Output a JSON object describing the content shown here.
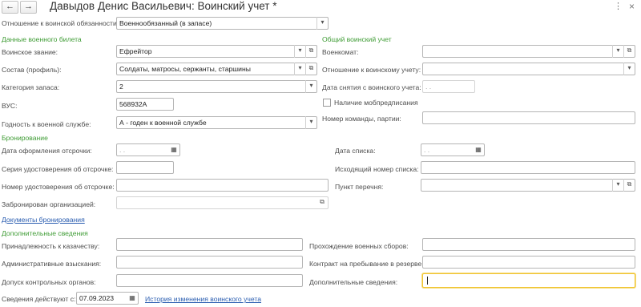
{
  "window": {
    "title": "Давыдов Денис Васильевич: Воинский учет *",
    "back_icon": "←",
    "forward_icon": "→",
    "more_icon": "⋮",
    "close_icon": "×"
  },
  "relation": {
    "label": "Отношение к воинской обязанности:",
    "value": "Военнообязанный (в запасе)"
  },
  "military_ticket": {
    "heading": "Данные военного билета",
    "rank_label": "Воинское звание:",
    "rank_value": "Ефрейтор",
    "profile_label": "Состав (профиль):",
    "profile_value": "Солдаты, матросы, сержанты, старшины",
    "reserve_label": "Категория запаса:",
    "reserve_value": "2",
    "vus_label": "ВУС:",
    "vus_value": "568932А",
    "fitness_label": "Годность к военной службе:",
    "fitness_value": "А - годен к военной службе"
  },
  "general": {
    "heading": "Общий воинский учет",
    "office_label": "Военкомат:",
    "office_value": "",
    "relation_label": "Отношение к воинскому учету:",
    "relation_value": "",
    "removal_label": "Дата снятия с воинского учета:",
    "removal_value": " .  .",
    "mob_label": "Наличие мобпредписания",
    "team_label": "Номер команды, партии:",
    "team_value": ""
  },
  "reservation": {
    "heading": "Бронирование",
    "deferral_date_label": "Дата оформления отсрочки:",
    "deferral_date_value": " .  .",
    "series_label": "Серия удостоверения об отсрочке:",
    "series_value": "",
    "number_label": "Номер удостоверения об отсрочке:",
    "number_value": "",
    "org_label": "Забронирован организацией:",
    "org_value": "",
    "list_date_label": "Дата списка:",
    "list_date_value": " .  .",
    "outgoing_label": "Исходящий номер списка:",
    "outgoing_value": "",
    "item_label": "Пункт перечня:",
    "item_value": "",
    "documents_link": "Документы бронирования"
  },
  "additional": {
    "heading": "Дополнительные сведения",
    "cossack_label": "Принадлежность к казачеству:",
    "cossack_value": "",
    "penalties_label": "Административные взыскания:",
    "penalties_value": "",
    "control_label": "Допуск контрольных органов:",
    "control_value": "",
    "training_label": "Прохождение военных сборов:",
    "training_value": "",
    "contract_label": "Контракт на пребывание в резерве:",
    "contract_value": "",
    "extra_label": "Дополнительные сведения:",
    "extra_value": ""
  },
  "footer": {
    "effective_label": "Сведения действуют с:",
    "effective_value": "07.09.2023",
    "history_link": "История изменения воинского учета"
  },
  "icons": {
    "dropdown": "▾",
    "select": "···",
    "open": "⧉",
    "calendar": "▦"
  },
  "colors": {
    "section": "#3f9c35",
    "link": "#2a5db0",
    "focus": "#f0c431"
  }
}
